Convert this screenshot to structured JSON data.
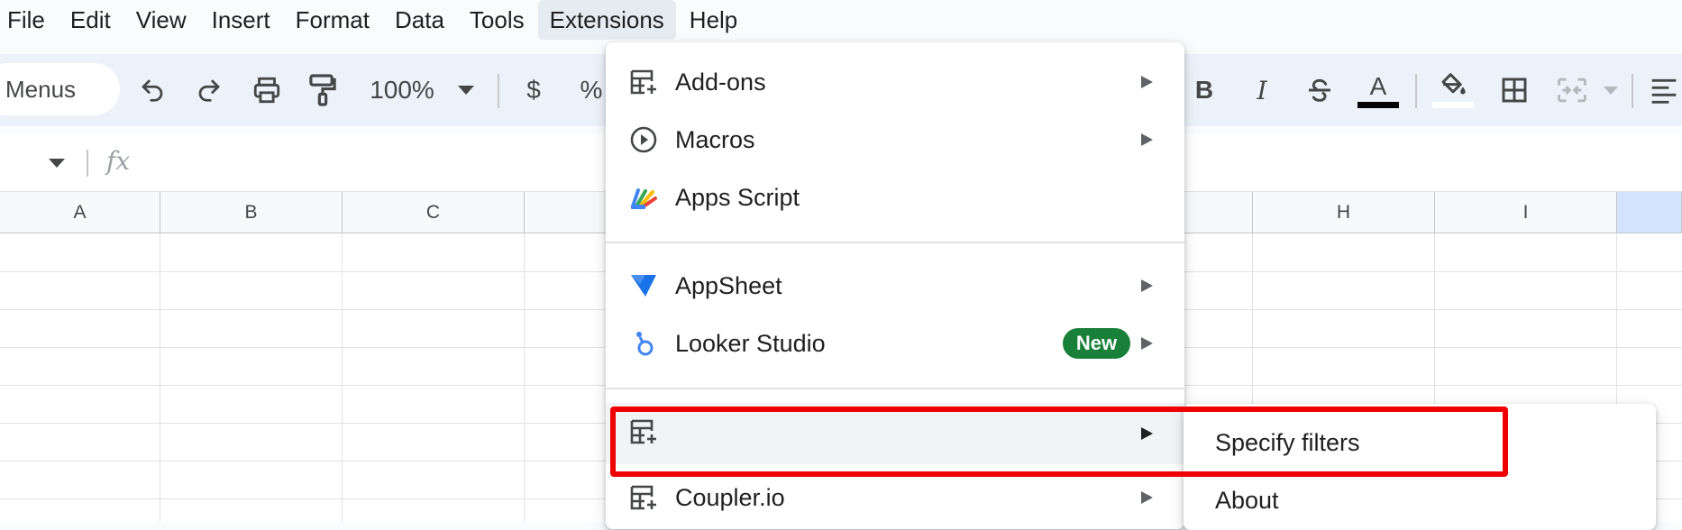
{
  "menubar": {
    "items": [
      "File",
      "Edit",
      "View",
      "Insert",
      "Format",
      "Data",
      "Tools",
      "Extensions",
      "Help"
    ],
    "active": "Extensions"
  },
  "toolbar": {
    "search_text": "Menus",
    "zoom": "100%",
    "currency": "$",
    "percent": "%",
    "icons": [
      "undo-icon",
      "redo-icon",
      "print-icon",
      "paint-format-icon",
      "zoom-dropdown-icon",
      "bold-icon",
      "italic-icon",
      "strikethrough-icon",
      "text-color-icon",
      "fill-color-icon",
      "borders-icon",
      "merge-cells-icon",
      "align-icon"
    ],
    "bold_label": "B",
    "italic_label": "I",
    "text_color_label": "A"
  },
  "formula_bar": {
    "fx": "fx"
  },
  "grid": {
    "columns": [
      "A",
      "B",
      "C",
      "",
      "",
      "",
      "",
      "H",
      "I",
      ""
    ]
  },
  "extensions_menu": {
    "items": [
      {
        "label": "Add-ons",
        "icon": "add-ons-icon",
        "submenu": true
      },
      {
        "label": "Macros",
        "icon": "macros-play-icon",
        "submenu": true
      },
      {
        "label": "Apps Script",
        "icon": "apps-script-icon",
        "submenu": false
      },
      {
        "label": "AppSheet",
        "icon": "appsheet-icon",
        "submenu": true
      },
      {
        "label": "Looker Studio",
        "icon": "looker-studio-icon",
        "submenu": true,
        "badge": "New"
      },
      {
        "label": "",
        "icon": "add-on-table-icon",
        "submenu": true,
        "highlighted": true
      },
      {
        "label": "Coupler.io",
        "icon": "coupler-table-icon",
        "submenu": true
      }
    ]
  },
  "submenu": {
    "items": [
      "Specify filters",
      "About"
    ]
  },
  "colors": {
    "highlight": "#ee0000",
    "badge": "#188038",
    "appsheet": "#1a73e8",
    "selected_column": "#d3e3fd"
  }
}
